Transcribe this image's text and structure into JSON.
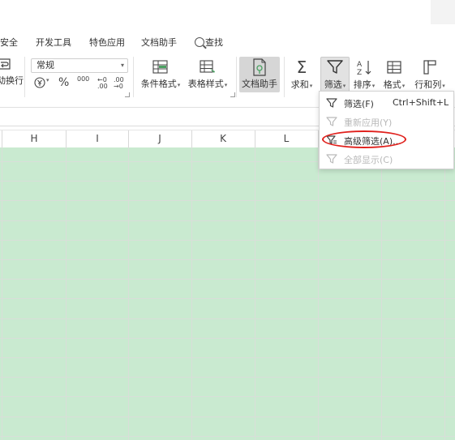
{
  "menu": {
    "tabs": [
      "安全",
      "开发工具",
      "特色应用",
      "文档助手",
      "查找"
    ]
  },
  "ribbon": {
    "wrap_label": "动换行",
    "number_format": "常规",
    "percent": "%",
    "thousands": "000",
    "increase_decimal": "←0 .00",
    "decrease_decimal": ".00 →0",
    "conditional_format": "条件格式",
    "table_style": "表格样式",
    "doc_assistant": "文档助手",
    "sum": "求和",
    "filter": "筛选",
    "sort": "排序",
    "format": "格式",
    "row_col": "行和列"
  },
  "columns": [
    "H",
    "I",
    "J",
    "K",
    "L"
  ],
  "filter_menu": {
    "items": [
      {
        "label": "筛选(F)",
        "shortcut": "Ctrl+Shift+L",
        "enabled": true
      },
      {
        "label": "重新应用(Y)",
        "shortcut": "",
        "enabled": false
      },
      {
        "label": "高级筛选(A)...",
        "shortcut": "",
        "enabled": true
      },
      {
        "label": "全部显示(C)",
        "shortcut": "",
        "enabled": false
      }
    ]
  },
  "colors": {
    "grid_fill": "#c9ead0",
    "highlight_ring": "#e0201c",
    "active_button": "#d6d6d6"
  }
}
